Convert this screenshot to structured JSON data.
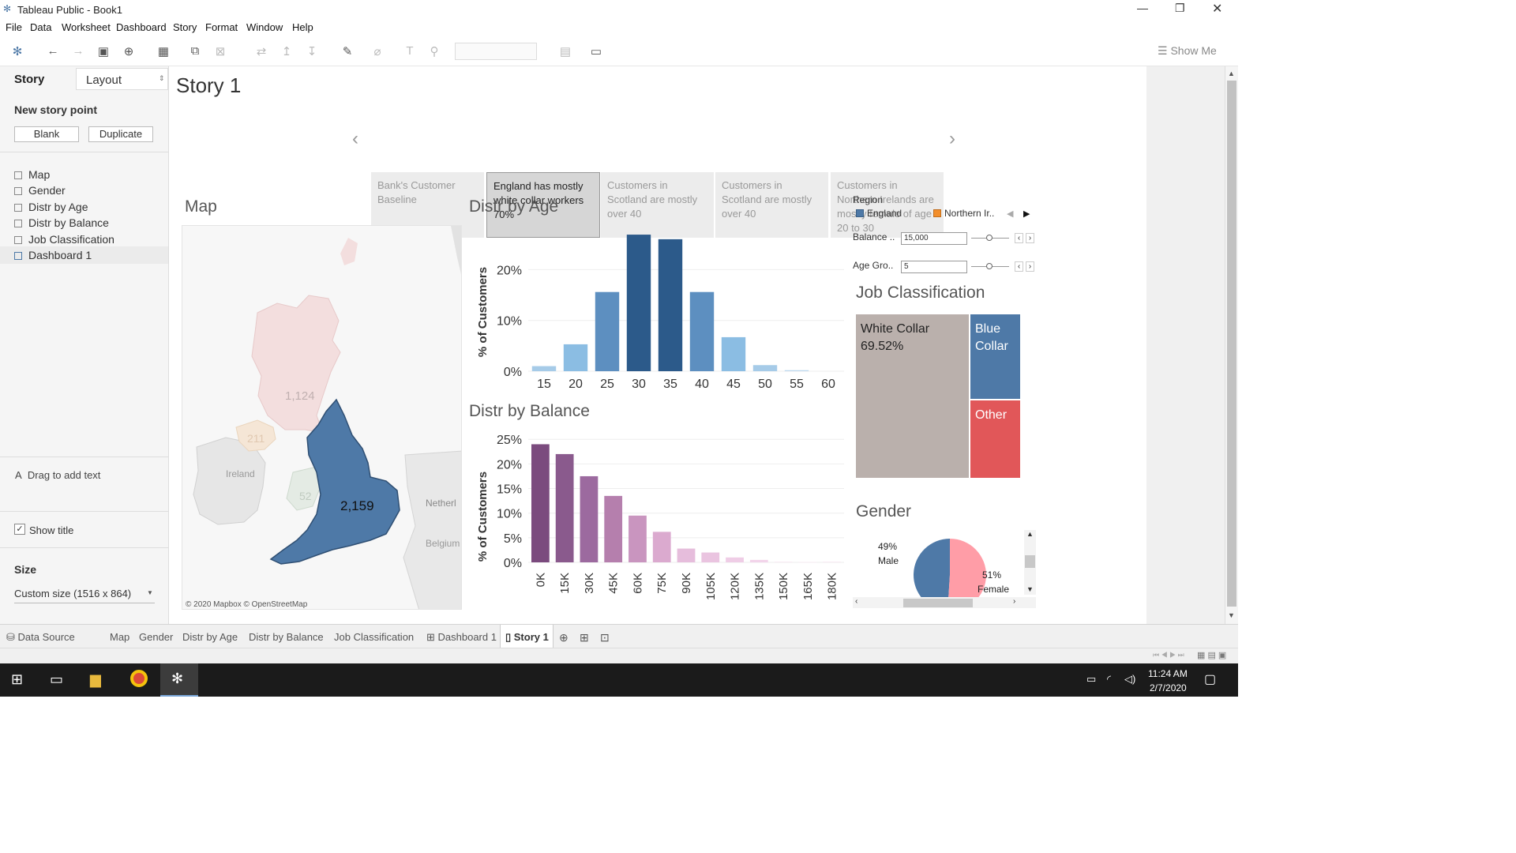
{
  "window": {
    "title": "Tableau Public - Book1"
  },
  "menu": [
    "File",
    "Data",
    "Worksheet",
    "Dashboard",
    "Story",
    "Format",
    "Window",
    "Help"
  ],
  "toolbar": {
    "show_me": "Show Me"
  },
  "sidebar": {
    "tab_story": "Story",
    "tab_layout": "Layout",
    "new_story_point": "New story point",
    "blank": "Blank",
    "duplicate": "Duplicate",
    "sheets": [
      "Map",
      "Gender",
      "Distr by Age",
      "Distr by Balance",
      "Job Classification",
      "Dashboard 1"
    ],
    "drag_text": "Drag to add text",
    "show_title": "Show title",
    "size_label": "Size",
    "size_value": "Custom size (1516 x 864)"
  },
  "story": {
    "title": "Story 1",
    "points": [
      "Bank's Customer Baseline",
      "England has mostly white collar workers 70%",
      "Customers in Scotland are mostly over 40",
      "Customers in Scotland are mostly over 40",
      "Customers in Northern Irelands are mostly female of age 20 to 30"
    ],
    "active_index": 1
  },
  "map": {
    "title": "Map",
    "labels": {
      "england": "2,159",
      "scotland": "1,124",
      "ni": "211",
      "wales": "52",
      "ireland": "Ireland",
      "netherl": "Netherl",
      "belgium": "Belgium"
    },
    "attribution": "© 2020 Mapbox © OpenStreetMap"
  },
  "filters": {
    "region_label": "Region",
    "region_england": "England",
    "region_ni": "Northern Ir..",
    "balance_label": "Balance ..",
    "balance_value": "15,000",
    "age_label": "Age Gro..",
    "age_value": "5",
    "colors": {
      "england": "#4e79a7",
      "ni": "#f28e2b"
    }
  },
  "chart_data": [
    {
      "type": "bar",
      "title": "Distr by Age",
      "ylabel": "% of Customers",
      "categories": [
        "15",
        "20",
        "25",
        "30",
        "35",
        "40",
        "45",
        "50",
        "55",
        "60"
      ],
      "yticks": [
        "0%",
        "10%",
        "20%"
      ],
      "values": [
        1.0,
        5.3,
        15.6,
        26.9,
        26.0,
        15.6,
        6.7,
        1.2,
        0.2,
        0
      ],
      "ylim": [
        0,
        28
      ]
    },
    {
      "type": "bar",
      "title": "Distr by Balance",
      "ylabel": "% of Customers",
      "categories": [
        "0K",
        "15K",
        "30K",
        "45K",
        "60K",
        "75K",
        "90K",
        "105K",
        "120K",
        "135K",
        "150K",
        "165K",
        "180K"
      ],
      "yticks": [
        "0%",
        "5%",
        "10%",
        "15%",
        "20%",
        "25%"
      ],
      "values": [
        24.0,
        22.0,
        17.5,
        13.5,
        9.5,
        6.2,
        2.8,
        2.0,
        1.0,
        0.5,
        0.1,
        0.05,
        0.1
      ],
      "ylim": [
        0,
        26
      ]
    },
    {
      "type": "treemap",
      "title": "Job Classification",
      "items": [
        {
          "label": "White Collar",
          "value_label": "69.52%"
        },
        {
          "label": "Blue Collar"
        },
        {
          "label": "Other"
        }
      ]
    },
    {
      "type": "pie",
      "title": "Gender",
      "slices": [
        {
          "label": "Male",
          "pct_label": "49%",
          "value": 49
        },
        {
          "label": "Female",
          "pct_label": "51%",
          "value": 51
        }
      ]
    }
  ],
  "tabs": [
    "Data Source",
    "Map",
    "Gender",
    "Distr by Age",
    "Distr by Balance",
    "Job Classification",
    "Dashboard 1",
    "Story 1"
  ],
  "taskbar": {
    "time": "11:24 AM",
    "date": "2/7/2020"
  }
}
